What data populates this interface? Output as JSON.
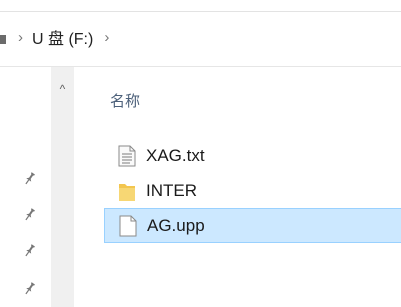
{
  "breadcrumb": {
    "separator": "›",
    "items": [
      {
        "label": "U 盘 (F:)"
      }
    ]
  },
  "nav_pane": {
    "scroll_up_glyph": "^",
    "pin_glyph": "📌"
  },
  "columns": {
    "name": "名称"
  },
  "files": [
    {
      "name": "XAG.txt",
      "icon": "text-file-icon",
      "selected": false
    },
    {
      "name": "INTER",
      "icon": "folder-icon",
      "selected": false
    },
    {
      "name": "AG.upp",
      "icon": "blank-file-icon",
      "selected": true
    }
  ],
  "colors": {
    "selection_fill": "#cce8ff",
    "selection_border": "#99d1ff",
    "folder": "#f3c64f",
    "header_text": "#4c607a"
  }
}
